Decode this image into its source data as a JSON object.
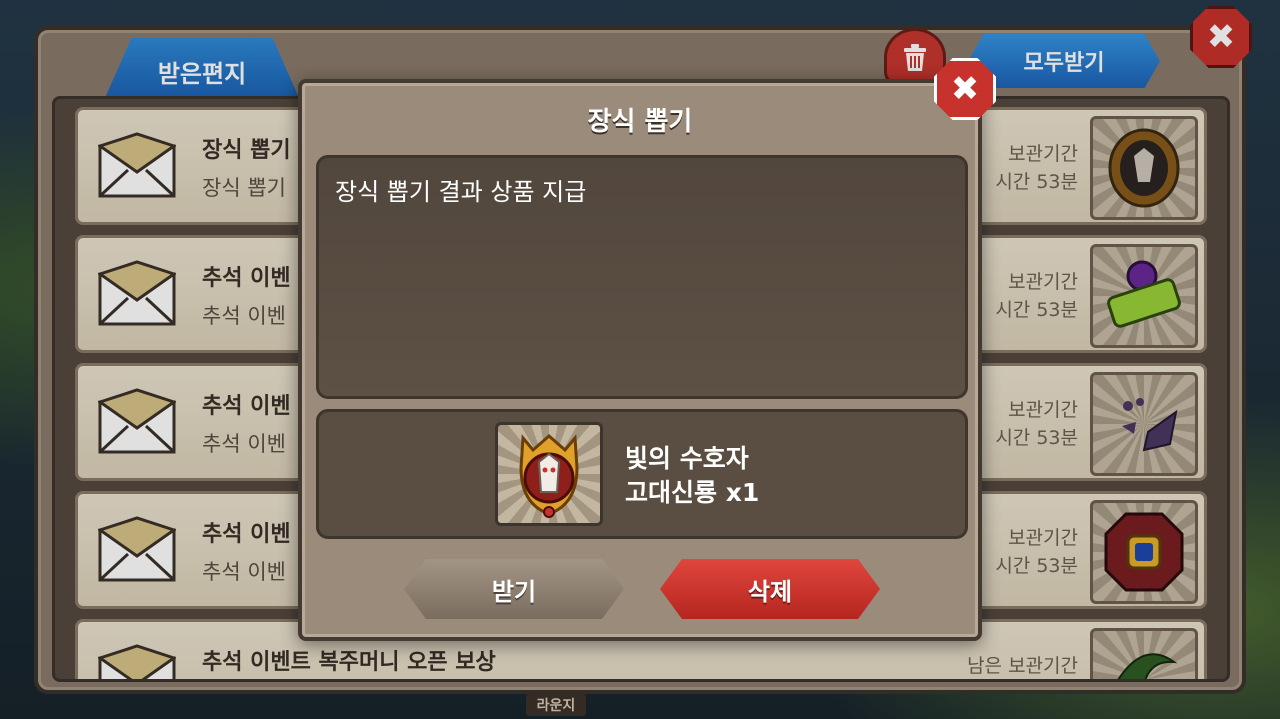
{
  "mailbox": {
    "tab_label": "받은편지",
    "receive_all_label": "모두받기",
    "trash_icon": "trash-icon",
    "close_icon": "close-icon",
    "rows": [
      {
        "title": "장식 뽑기",
        "sub": "장식 뽑기",
        "expire_label": "보관기간",
        "expire_time": "시간 53분",
        "item_icon": "dragon-emblem-icon"
      },
      {
        "title": "추석 이벤",
        "sub": "추석 이벤",
        "expire_label": "보관기간",
        "expire_time": "시간 53분",
        "item_icon": "level-up-ticket-icon"
      },
      {
        "title": "추석 이벤",
        "sub": "추석 이벤",
        "expire_label": "보관기간",
        "expire_time": "시간 53분",
        "item_icon": "stone-shards-icon"
      },
      {
        "title": "추석 이벤",
        "sub": "추석 이벤",
        "expire_label": "보관기간",
        "expire_time": "시간 53분",
        "item_icon": "gem-frame-icon"
      },
      {
        "title": "추석 이벤트 복주머니 오픈 보상",
        "sub": "",
        "expire_label": "남은 보관기간",
        "expire_time": "",
        "item_icon": "plant-icon"
      }
    ],
    "bottom_tag": "라운지"
  },
  "modal": {
    "title": "장식 뽑기",
    "message": "장식 뽑기 결과 상품 지급",
    "reward_name_line1": "빛의 수호자",
    "reward_name_line2": "고대신룡 x1",
    "reward_icon": "ancient-dragon-emblem-icon",
    "receive_label": "받기",
    "delete_label": "삭제",
    "close_icon": "close-icon"
  },
  "colors": {
    "accent_blue": "#1d64b8",
    "delete_red": "#c8322c",
    "panel_brown": "#9a8b7b"
  }
}
